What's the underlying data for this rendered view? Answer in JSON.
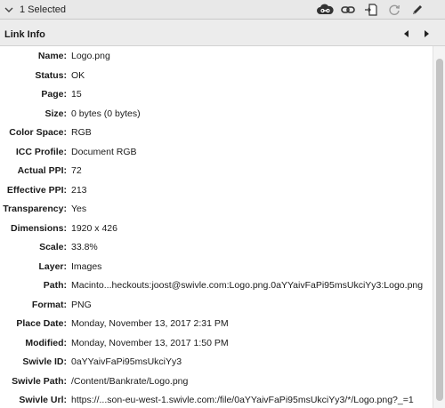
{
  "header": {
    "selected_text": "1 Selected"
  },
  "toolbar": {
    "icons": [
      "cloud-link-icon",
      "chain-link-icon",
      "relink-icon",
      "update-link-icon",
      "edit-pencil-icon"
    ]
  },
  "section": {
    "title": "Link Info"
  },
  "info": {
    "rows": [
      {
        "label": "Name:",
        "value": "Logo.png"
      },
      {
        "label": "Status:",
        "value": "OK"
      },
      {
        "label": "Page:",
        "value": "15"
      },
      {
        "label": "Size:",
        "value": "0 bytes (0 bytes)"
      },
      {
        "label": "Color Space:",
        "value": "RGB"
      },
      {
        "label": "ICC Profile:",
        "value": "Document RGB"
      },
      {
        "label": "Actual PPI:",
        "value": "72"
      },
      {
        "label": "Effective PPI:",
        "value": "213"
      },
      {
        "label": "Transparency:",
        "value": "Yes"
      },
      {
        "label": "Dimensions:",
        "value": "1920 x 426"
      },
      {
        "label": "Scale:",
        "value": "33.8%"
      },
      {
        "label": "Layer:",
        "value": "Images"
      },
      {
        "label": "Path:",
        "value": "Macinto...heckouts:joost@swivle.com:Logo.png.0aYYaivFaPi95msUkciYy3:Logo.png"
      },
      {
        "label": "Format:",
        "value": "PNG"
      },
      {
        "label": "Place Date:",
        "value": "Monday, November 13, 2017 2:31 PM"
      },
      {
        "label": "Modified:",
        "value": "Monday, November 13, 2017 1:50 PM"
      },
      {
        "label": "Swivle ID:",
        "value": "0aYYaivFaPi95msUkciYy3"
      },
      {
        "label": "Swivle Path:",
        "value": "/Content/Bankrate/Logo.png"
      },
      {
        "label": "Swivle Url:",
        "value": "https://...son-eu-west-1.swivle.com:/file/0aYYaivFaPi95msUkciYy3/*/Logo.png?_=1"
      }
    ]
  }
}
